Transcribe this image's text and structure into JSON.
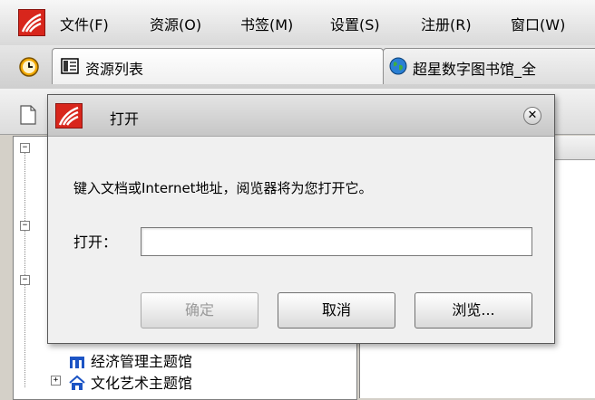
{
  "menubar": {
    "items": [
      "文件(F)",
      "资源(O)",
      "书签(M)",
      "设置(S)",
      "注册(R)",
      "窗口(W)"
    ]
  },
  "tabs": [
    {
      "label": "资源列表",
      "active": true
    },
    {
      "label": "超星数字图书馆_全",
      "active": false
    }
  ],
  "tree": {
    "rows": [
      "经济管理主题馆",
      "文化艺术主题馆"
    ]
  },
  "dialog": {
    "title": "打开",
    "prompt": "键入文档或Internet地址，阅览器将为您打开它。",
    "open_label": "打开：",
    "input_value": "",
    "buttons": {
      "ok": "确定",
      "cancel": "取消",
      "browse": "浏览..."
    }
  },
  "colors": {
    "brand_red": "#d8261c",
    "window_gray": "#d4d0c8"
  }
}
